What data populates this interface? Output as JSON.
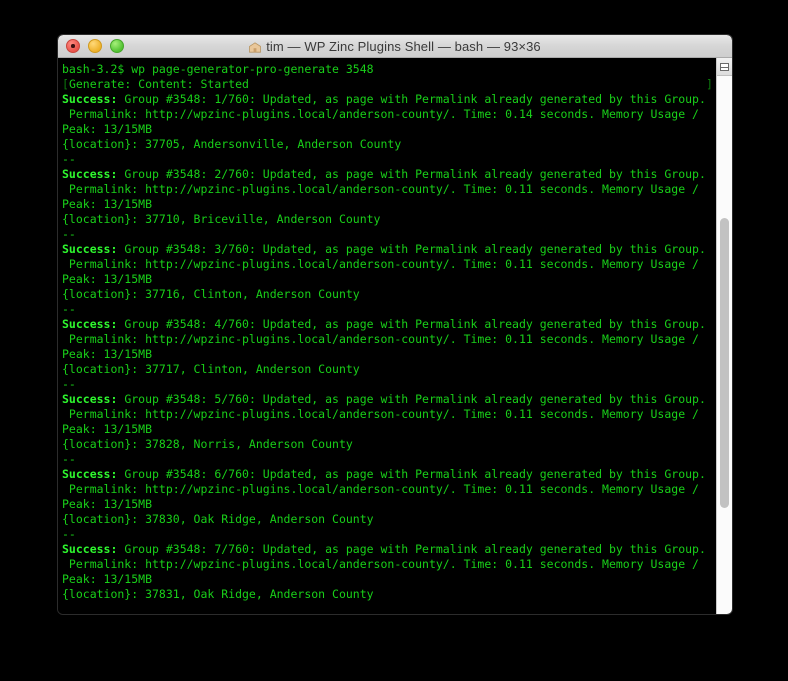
{
  "window": {
    "title": "tim — WP Zinc Plugins Shell — bash — 93×36",
    "folder_icon": "home-folder-icon",
    "traffic_lights": [
      {
        "name": "close-button",
        "color": "#e8534a"
      },
      {
        "name": "minimize-button",
        "color": "#eeb12a"
      },
      {
        "name": "maximize-button",
        "color": "#52c232"
      }
    ]
  },
  "scrollbar": {
    "button_icon": "split-pane-icon"
  },
  "colors": {
    "background": "#000000",
    "text_green": "#19d019",
    "bold_green": "#2ef72e",
    "titlebar": "#d6d6d6"
  },
  "terminal": {
    "prompt": "bash-3.2$",
    "command": "wp page-generator-pro-generate 3548",
    "status_line": "Generate: Content: Started",
    "escape_prefix": "[",
    "escape_suffix": "]",
    "separator": "--",
    "group_id": "#3548",
    "total": "760",
    "memory_line": "Peak: 13/15MB",
    "permalink_base": "http://wpzinc-plugins.local/anderson-county/",
    "success_prefix": "Success:",
    "blocks": [
      {
        "success": "Success: Group #3548: 1/760: Updated, as page with Permalink already generated by this Group.",
        "permalink": " Permalink: http://wpzinc-plugins.local/anderson-county/. Time: 0.14 seconds. Memory Usage /",
        "peak": "Peak: 13/15MB",
        "location": "{location}: 37705, Andersonville, Anderson County",
        "index": "1/760",
        "time": "0.14",
        "zip": "37705",
        "city": "Andersonville",
        "county": "Anderson County"
      },
      {
        "success": "Success: Group #3548: 2/760: Updated, as page with Permalink already generated by this Group.",
        "permalink": " Permalink: http://wpzinc-plugins.local/anderson-county/. Time: 0.11 seconds. Memory Usage /",
        "peak": "Peak: 13/15MB",
        "location": "{location}: 37710, Briceville, Anderson County",
        "index": "2/760",
        "time": "0.11",
        "zip": "37710",
        "city": "Briceville",
        "county": "Anderson County"
      },
      {
        "success": "Success: Group #3548: 3/760: Updated, as page with Permalink already generated by this Group.",
        "permalink": " Permalink: http://wpzinc-plugins.local/anderson-county/. Time: 0.11 seconds. Memory Usage /",
        "peak": "Peak: 13/15MB",
        "location": "{location}: 37716, Clinton, Anderson County",
        "index": "3/760",
        "time": "0.11",
        "zip": "37716",
        "city": "Clinton",
        "county": "Anderson County"
      },
      {
        "success": "Success: Group #3548: 4/760: Updated, as page with Permalink already generated by this Group.",
        "permalink": " Permalink: http://wpzinc-plugins.local/anderson-county/. Time: 0.11 seconds. Memory Usage /",
        "peak": "Peak: 13/15MB",
        "location": "{location}: 37717, Clinton, Anderson County",
        "index": "4/760",
        "time": "0.11",
        "zip": "37717",
        "city": "Clinton",
        "county": "Anderson County"
      },
      {
        "success": "Success: Group #3548: 5/760: Updated, as page with Permalink already generated by this Group.",
        "permalink": " Permalink: http://wpzinc-plugins.local/anderson-county/. Time: 0.11 seconds. Memory Usage /",
        "peak": "Peak: 13/15MB",
        "location": "{location}: 37828, Norris, Anderson County",
        "index": "5/760",
        "time": "0.11",
        "zip": "37828",
        "city": "Norris",
        "county": "Anderson County"
      },
      {
        "success": "Success: Group #3548: 6/760: Updated, as page with Permalink already generated by this Group.",
        "permalink": " Permalink: http://wpzinc-plugins.local/anderson-county/. Time: 0.11 seconds. Memory Usage /",
        "peak": "Peak: 13/15MB",
        "location": "{location}: 37830, Oak Ridge, Anderson County",
        "index": "6/760",
        "time": "0.11",
        "zip": "37830",
        "city": "Oak Ridge",
        "county": "Anderson County"
      },
      {
        "success": "Success: Group #3548: 7/760: Updated, as page with Permalink already generated by this Group.",
        "permalink": " Permalink: http://wpzinc-plugins.local/anderson-county/. Time: 0.11 seconds. Memory Usage /",
        "peak": "Peak: 13/15MB",
        "location": "{location}: 37831, Oak Ridge, Anderson County",
        "index": "7/760",
        "time": "0.11",
        "zip": "37831",
        "city": "Oak Ridge",
        "county": "Anderson County"
      }
    ]
  }
}
